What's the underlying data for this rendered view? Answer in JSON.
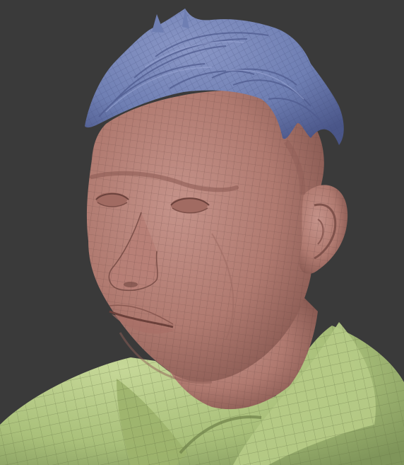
{
  "viewport": {
    "background_color": "#3a3a3a"
  },
  "model": {
    "parts": [
      {
        "name": "skin",
        "color": "#b07a70"
      },
      {
        "name": "hair",
        "color": "#6f7fb3"
      },
      {
        "name": "shirt",
        "color": "#a9c07a"
      }
    ],
    "wireframe": true,
    "wire_color": "#3a2f2f"
  }
}
